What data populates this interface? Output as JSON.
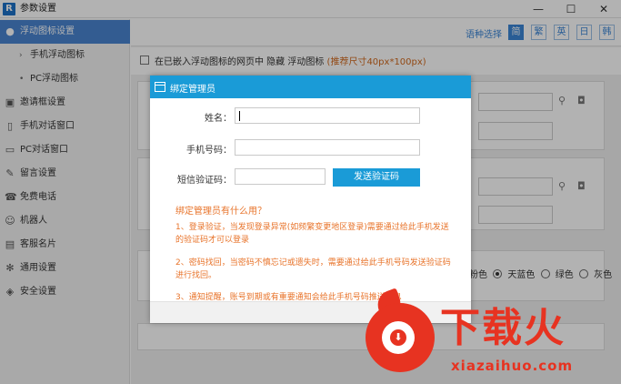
{
  "window": {
    "title": "参数设置",
    "logo_letter": "R",
    "controls": {
      "minimize": "—",
      "maximize": "☐",
      "close": "✕"
    }
  },
  "sidebar": {
    "items": [
      {
        "label": "浮动图标设置",
        "icon": "float-icon"
      },
      {
        "label": "手机浮动图标",
        "bullet": "›"
      },
      {
        "label": "PC浮动图标",
        "bullet": "•"
      },
      {
        "label": "邀请框设置",
        "icon": "invite-icon"
      },
      {
        "label": "手机对话窗口",
        "icon": "phone-icon"
      },
      {
        "label": "PC对话窗口",
        "icon": "monitor-icon"
      },
      {
        "label": "留言设置",
        "icon": "message-icon"
      },
      {
        "label": "免费电话",
        "icon": "telephone-icon"
      },
      {
        "label": "机器人",
        "icon": "robot-icon"
      },
      {
        "label": "客服名片",
        "icon": "card-icon"
      },
      {
        "label": "通用设置",
        "icon": "gear-icon"
      },
      {
        "label": "安全设置",
        "icon": "shield-icon"
      }
    ]
  },
  "lang": {
    "label": "语种选择",
    "options": [
      "简",
      "繁",
      "英",
      "日",
      "韩"
    ],
    "selected": "简"
  },
  "embed": {
    "text": "在已嵌入浮动图标的网页中 隐藏 浮动图标",
    "hint": "(推荐尺寸40px*100px)"
  },
  "colors_row": {
    "options": [
      "粉色",
      "天蓝色",
      "绿色",
      "灰色"
    ],
    "selected": "天蓝色"
  },
  "dialog": {
    "title": "绑定管理员",
    "name_label": "姓名：",
    "phone_label": "手机号码：",
    "code_label": "短信验证码：",
    "send_button": "发送验证码",
    "help_title": "绑定管理员有什么用？",
    "help_1": "1、登录验证，当发现登录异常(如频繁变更地区登录)需要通过给此手机发送的验证码才可以登录",
    "help_2": "2、密码找回，当密码不慎忘记或遗失时，需要通过给此手机号码发送验证码进行找回。",
    "help_3": "3、通知提醒，账号到期或有重要通知会给此手机号码推送消息"
  },
  "watermark": {
    "brand": "下载火",
    "url": "xiazaihuo.com"
  },
  "accent_color": "#1a9bd7",
  "hint_color": "#e8742b"
}
